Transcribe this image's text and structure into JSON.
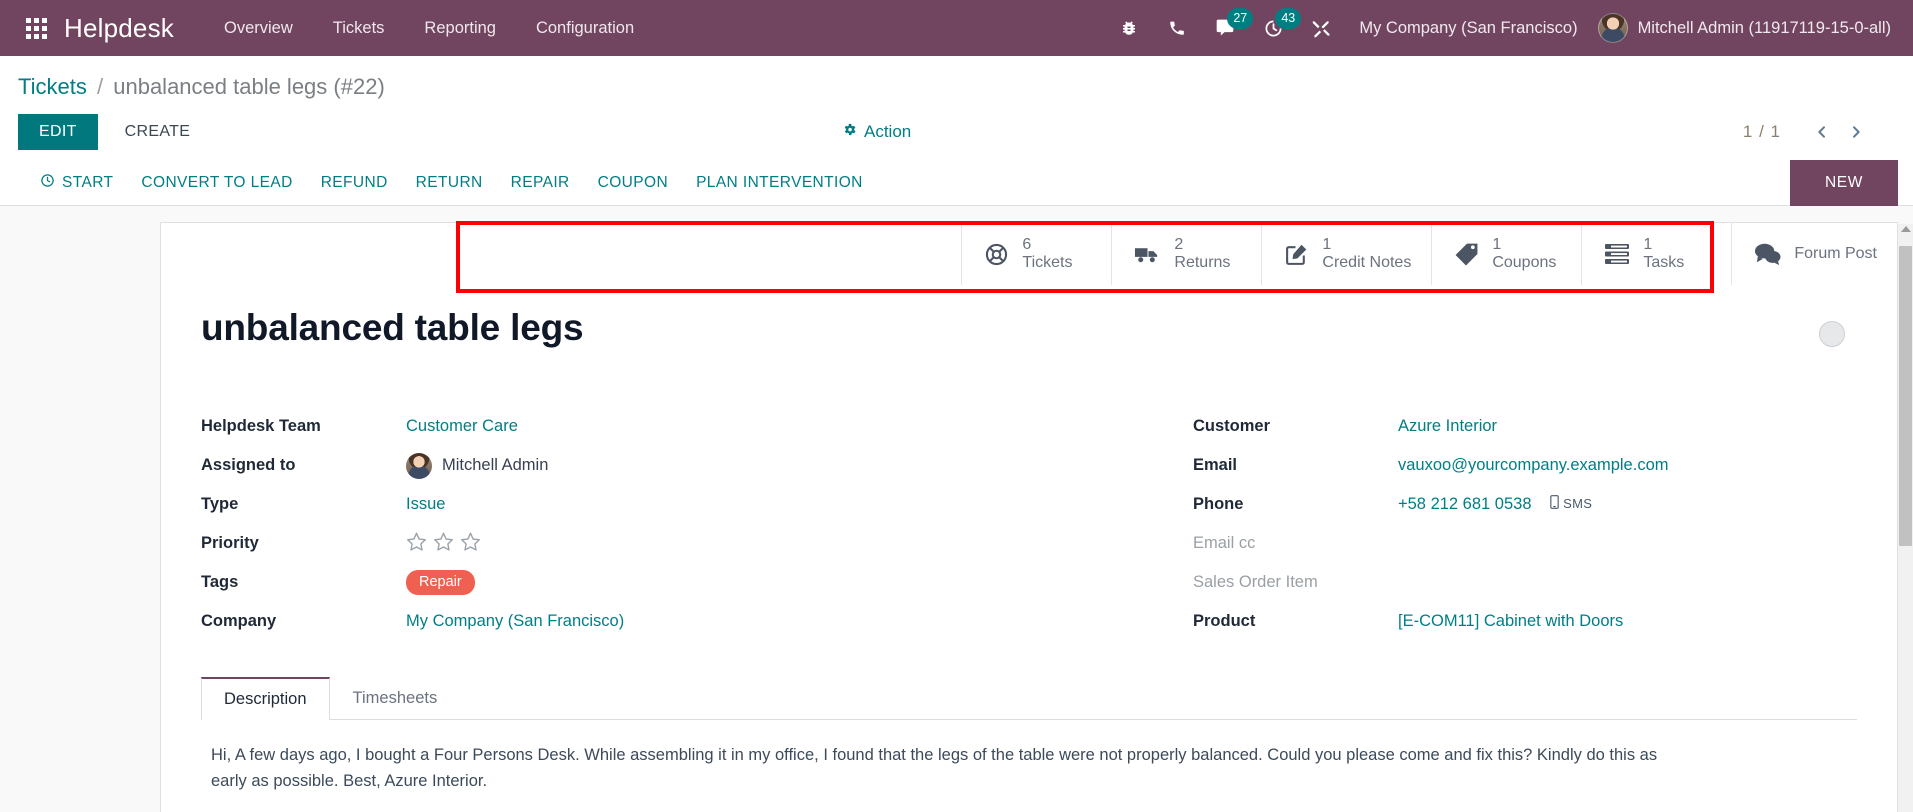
{
  "navbar": {
    "apps_icon": "apps-grid-icon",
    "brand": "Helpdesk",
    "menu": [
      {
        "label": "Overview"
      },
      {
        "label": "Tickets"
      },
      {
        "label": "Reporting"
      },
      {
        "label": "Configuration"
      }
    ],
    "sys_icons": [
      {
        "name": "bug-icon",
        "badge": null
      },
      {
        "name": "phone-icon",
        "badge": null
      },
      {
        "name": "messages-icon",
        "badge": "27"
      },
      {
        "name": "activities-clock-icon",
        "badge": "43"
      },
      {
        "name": "tools-icon",
        "badge": null
      }
    ],
    "company": "My Company (San Francisco)",
    "user": "Mitchell Admin (11917119-15-0-all)",
    "badge_color": "#017e84",
    "bar_color": "#71455f"
  },
  "breadcrumb": {
    "parent": "Tickets",
    "separator": "/",
    "current": "unbalanced table legs (#22)"
  },
  "control": {
    "edit_label": "EDIT",
    "create_label": "CREATE",
    "action_label": "Action",
    "pager_count": "1 / 1",
    "prev_icon": "chevron-left-icon",
    "next_icon": "chevron-right-icon"
  },
  "buttonbar": {
    "buttons": [
      {
        "label": "START",
        "icon": "clock-icon"
      },
      {
        "label": "CONVERT TO LEAD",
        "icon": null
      },
      {
        "label": "REFUND",
        "icon": null
      },
      {
        "label": "RETURN",
        "icon": null
      },
      {
        "label": "REPAIR",
        "icon": null
      },
      {
        "label": "COUPON",
        "icon": null
      },
      {
        "label": "PLAN INTERVENTION",
        "icon": null
      }
    ],
    "status": "NEW"
  },
  "stat_buttons": [
    {
      "value": "6",
      "label": "Tickets",
      "icon": "lifebuoy-icon"
    },
    {
      "value": "2",
      "label": "Returns",
      "icon": "truck-icon"
    },
    {
      "value": "1",
      "label": "Credit Notes",
      "icon": "pencil-square-icon"
    },
    {
      "value": "1",
      "label": "Coupons",
      "icon": "tag-icon"
    },
    {
      "value": "1",
      "label": "Tasks",
      "icon": "tasks-list-icon"
    },
    {
      "value": "",
      "label": "Forum Post",
      "icon": "comments-icon"
    }
  ],
  "highlight": {
    "color": "#ff0000"
  },
  "record": {
    "title": "unbalanced table legs",
    "kanban_state_icon": "kanban-state-circle"
  },
  "form": {
    "left": [
      {
        "label": "Helpdesk Team",
        "value": "Customer Care",
        "kind": "link"
      },
      {
        "label": "Assigned to",
        "value": "Mitchell Admin",
        "kind": "avatar"
      },
      {
        "label": "Type",
        "value": "Issue",
        "kind": "link"
      },
      {
        "label": "Priority",
        "value": "",
        "kind": "stars",
        "stars": 3,
        "filled": 0
      },
      {
        "label": "Tags",
        "value": "Repair",
        "kind": "tag",
        "tag_color": "#f06050"
      },
      {
        "label": "Company",
        "value": "My Company (San Francisco)",
        "kind": "link"
      }
    ],
    "right": [
      {
        "label": "Customer",
        "value": "Azure Interior",
        "kind": "link"
      },
      {
        "label": "Email",
        "value": "vauxoo@yourcompany.example.com",
        "kind": "link"
      },
      {
        "label": "Phone",
        "value": "+58 212 681 0538",
        "kind": "phone",
        "sms_label": "SMS",
        "sms_icon": "mobile-icon"
      },
      {
        "label": "Email cc",
        "value": "",
        "kind": "empty"
      },
      {
        "label": "Sales Order Item",
        "value": "",
        "kind": "empty"
      },
      {
        "label": "Product",
        "value": "[E-COM11] Cabinet with Doors",
        "kind": "link"
      }
    ]
  },
  "notebook": {
    "tabs": [
      {
        "label": "Description",
        "active": true
      },
      {
        "label": "Timesheets",
        "active": false
      }
    ],
    "description": "Hi, A few days ago, I bought a Four Persons Desk. While assembling it in my office, I found that the legs of the table were not properly balanced. Could you please come and fix this? Kindly do this as early as possible. Best, Azure Interior."
  }
}
